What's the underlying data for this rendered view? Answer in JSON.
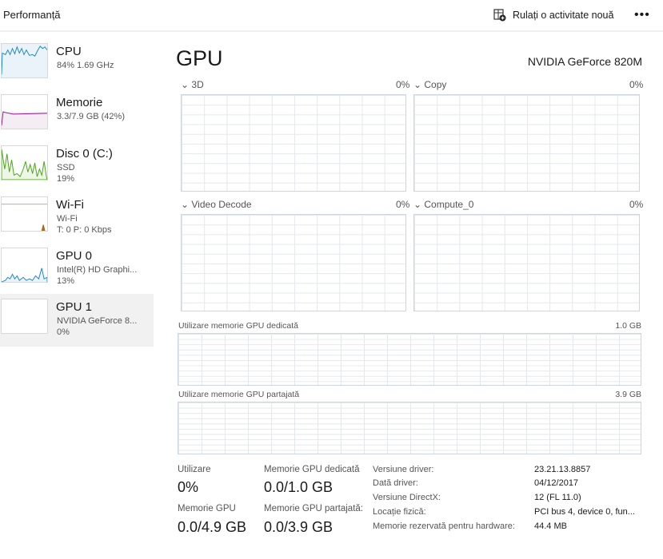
{
  "header": {
    "title": "Performanță",
    "run_task": "Rulați o activitate nouă",
    "more": "•••"
  },
  "sidebar": [
    {
      "name": "CPU",
      "line1": "84% 1.69 GHz",
      "line2": "",
      "color": "#1f86c0"
    },
    {
      "name": "Memorie",
      "line1": "3.3/7.9 GB (42%)",
      "line2": "",
      "color": "#8b1a8b"
    },
    {
      "name": "Disc 0 (C:)",
      "line1": "SSD",
      "line2": "19%",
      "color": "#4ca21a"
    },
    {
      "name": "Wi-Fi",
      "line1": "Wi-Fi",
      "line2": "T: 0 P: 0 Kbps",
      "color": "#a7692a"
    },
    {
      "name": "GPU 0",
      "line1": "Intel(R) HD Graphi...",
      "line2": "13%",
      "color": "#1f86c0"
    },
    {
      "name": "GPU 1",
      "line1": "NVIDIA GeForce 8...",
      "line2": "0%",
      "color": "#1f86c0"
    }
  ],
  "main": {
    "title": "GPU",
    "device": "NVIDIA GeForce 820M",
    "engines": [
      {
        "name": "3D",
        "value": "0%"
      },
      {
        "name": "Copy",
        "value": "0%"
      },
      {
        "name": "Video Decode",
        "value": "0%"
      },
      {
        "name": "Compute_0",
        "value": "0%"
      }
    ],
    "dedicated_graph": {
      "label": "Utilizare memorie GPU dedicată",
      "max": "1.0 GB"
    },
    "shared_graph": {
      "label": "Utilizare memorie GPU partajată",
      "max": "3.9 GB"
    },
    "stats": {
      "util_label": "Utilizare",
      "util": "0%",
      "ded_label": "Memorie GPU dedicată",
      "ded": "0.0/1.0 GB",
      "mem_label": "Memorie GPU",
      "mem": "0.0/4.9 GB",
      "shared_label": "Memorie GPU partajată:",
      "shared": "0.0/3.9 GB"
    },
    "details": [
      {
        "k": "Versiune driver:",
        "v": "23.21.13.8857"
      },
      {
        "k": "Dată driver:",
        "v": "04/12/2017"
      },
      {
        "k": "Versiune DirectX:",
        "v": "12 (FL 11.0)"
      },
      {
        "k": "Locație fizică:",
        "v": "PCI bus 4, device 0, fun..."
      },
      {
        "k": "Memorie rezervată pentru hardware:",
        "v": "44.4 MB"
      }
    ]
  }
}
